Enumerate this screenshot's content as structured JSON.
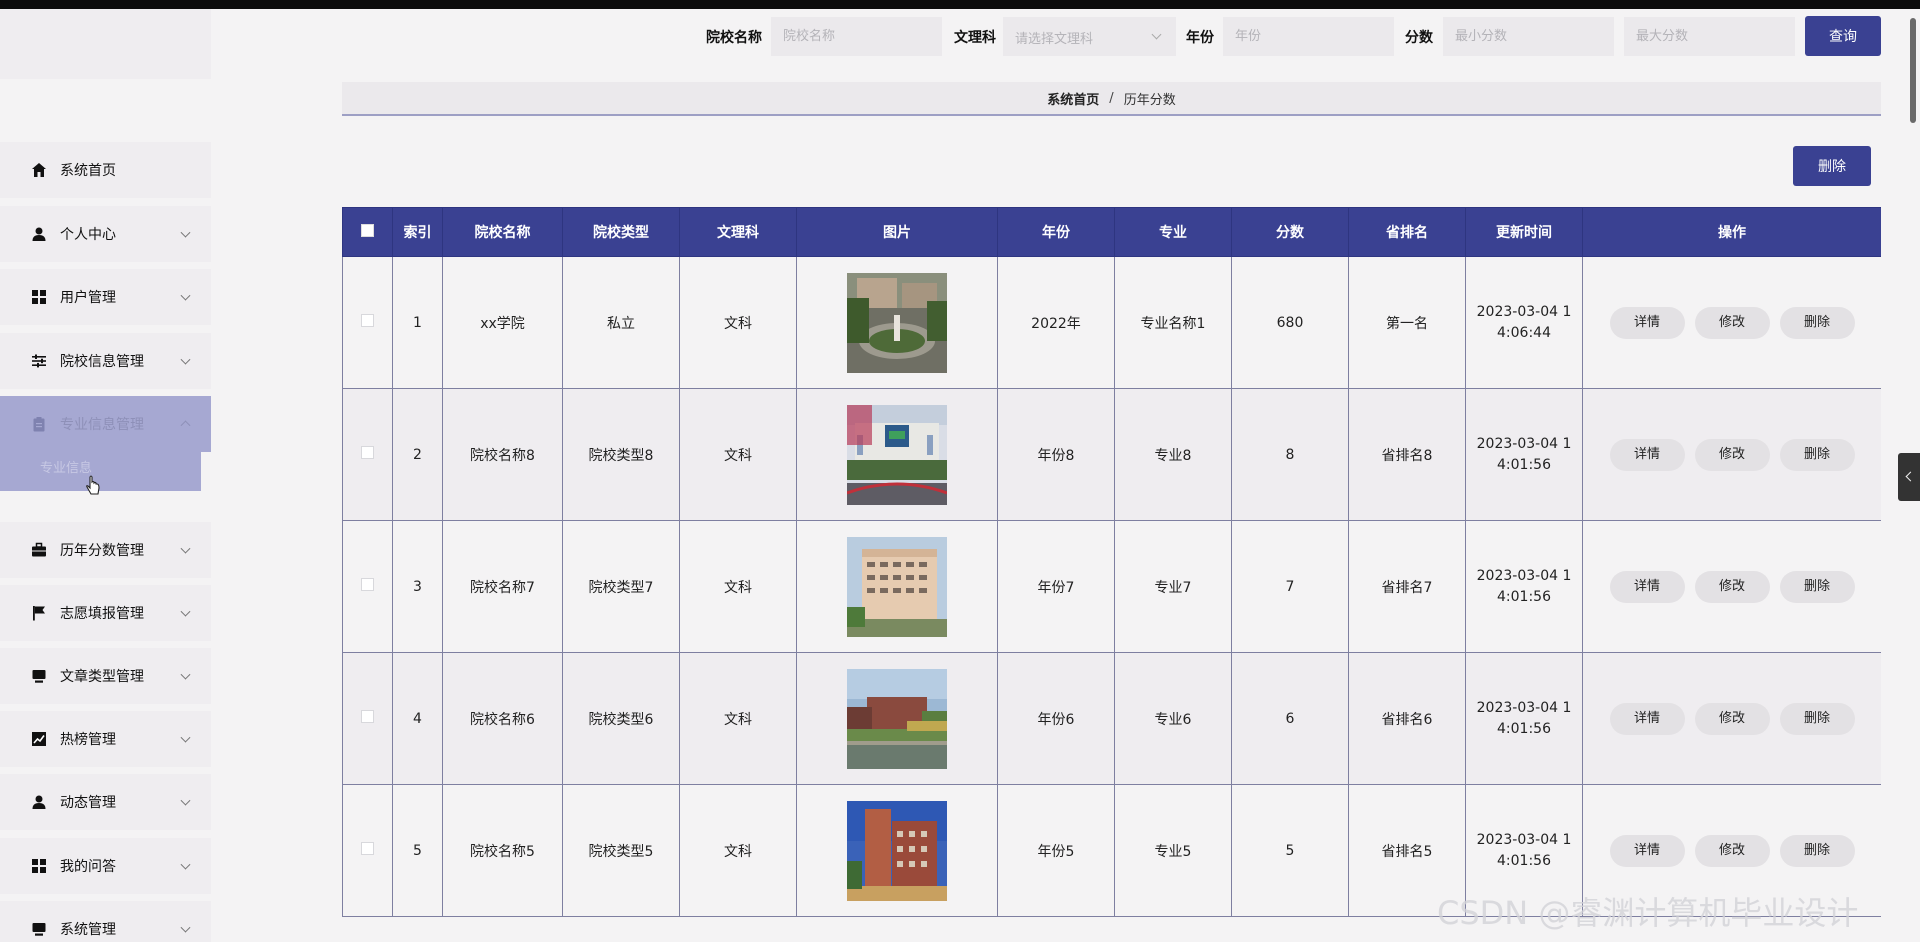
{
  "sidebar": {
    "items": [
      {
        "label": "系统首页",
        "icon": "home-icon",
        "name": "sidebar-item-home"
      },
      {
        "label": "个人中心",
        "icon": "user-icon",
        "name": "sidebar-item-personal"
      },
      {
        "label": "用户管理",
        "icon": "grid-icon",
        "name": "sidebar-item-users"
      },
      {
        "label": "院校信息管理",
        "icon": "sliders-icon",
        "name": "sidebar-item-colleges"
      },
      {
        "label": "专业信息管理",
        "icon": "clipboard-icon",
        "name": "sidebar-item-majors"
      },
      {
        "label": "历年分数管理",
        "icon": "briefcase-icon",
        "name": "sidebar-item-scores"
      },
      {
        "label": "志愿填报管理",
        "icon": "flag-icon",
        "name": "sidebar-item-applications"
      },
      {
        "label": "文章类型管理",
        "icon": "monitor-icon",
        "name": "sidebar-item-article-types"
      },
      {
        "label": "热榜管理",
        "icon": "chart-icon",
        "name": "sidebar-item-hot"
      },
      {
        "label": "动态管理",
        "icon": "user-icon",
        "name": "sidebar-item-news"
      },
      {
        "label": "我的问答",
        "icon": "grid-icon",
        "name": "sidebar-item-qa"
      },
      {
        "label": "系统管理",
        "icon": "monitor-icon",
        "name": "sidebar-item-system"
      }
    ],
    "submenu_label": "专业信息"
  },
  "filters": {
    "college_label": "院校名称",
    "college_placeholder": "院校名称",
    "subject_label": "文理科",
    "subject_placeholder": "请选择文理科",
    "year_label": "年份",
    "year_placeholder": "年份",
    "score_label": "分数",
    "min_placeholder": "最小分数",
    "max_placeholder": "最大分数",
    "query_label": "查询"
  },
  "breadcrumb": {
    "home": "系统首页",
    "separator": "/",
    "current": "历年分数"
  },
  "actions": {
    "delete_label": "删除"
  },
  "table": {
    "headers": [
      "索引",
      "院校名称",
      "院校类型",
      "文理科",
      "图片",
      "年份",
      "专业",
      "分数",
      "省排名",
      "更新时间",
      "操作"
    ],
    "rows": [
      {
        "index": "1",
        "college": "xx学院",
        "type": "私立",
        "subject": "文科",
        "year": "2022年",
        "major": "专业名称1",
        "score": "680",
        "rank": "第一名",
        "updated_line1": "2023-03-04 1",
        "updated_line2": "4:06:44"
      },
      {
        "index": "2",
        "college": "院校名称8",
        "type": "院校类型8",
        "subject": "文科",
        "year": "年份8",
        "major": "专业8",
        "score": "8",
        "rank": "省排名8",
        "updated_line1": "2023-03-04 1",
        "updated_line2": "4:01:56"
      },
      {
        "index": "3",
        "college": "院校名称7",
        "type": "院校类型7",
        "subject": "文科",
        "year": "年份7",
        "major": "专业7",
        "score": "7",
        "rank": "省排名7",
        "updated_line1": "2023-03-04 1",
        "updated_line2": "4:01:56"
      },
      {
        "index": "4",
        "college": "院校名称6",
        "type": "院校类型6",
        "subject": "文科",
        "year": "年份6",
        "major": "专业6",
        "score": "6",
        "rank": "省排名6",
        "updated_line1": "2023-03-04 1",
        "updated_line2": "4:01:56"
      },
      {
        "index": "5",
        "college": "院校名称5",
        "type": "院校类型5",
        "subject": "文科",
        "year": "年份5",
        "major": "专业5",
        "score": "5",
        "rank": "省排名5",
        "updated_line1": "2023-03-04 1",
        "updated_line2": "4:01:56"
      }
    ],
    "row_actions": {
      "detail": "详情",
      "edit": "修改",
      "delete": "删除"
    }
  },
  "watermark": "CSDN @睿渊计算机毕业设计",
  "colors": {
    "primary": "#3a4192",
    "active_menu": "#a6a8d2",
    "background": "#f4f3f4"
  }
}
